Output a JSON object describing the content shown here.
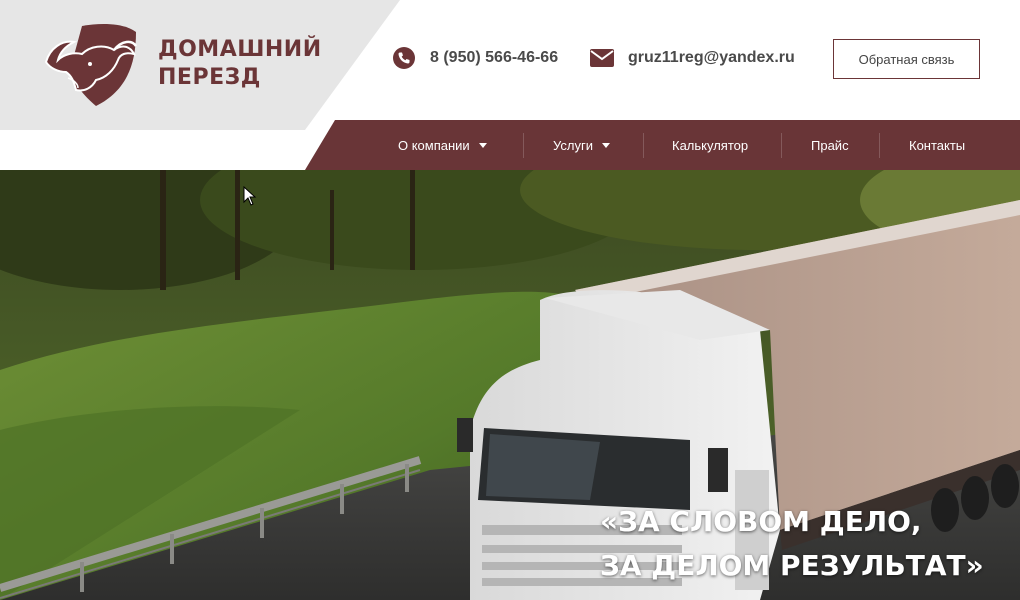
{
  "brand": {
    "line1": "ДОМАШНИЙ",
    "line2": "ПЕРЕЗД",
    "color": "#6b3537",
    "logo_icon": "bull-head-icon"
  },
  "contacts": {
    "phone": "8 (950) 566-46-66",
    "phone_icon": "phone-icon",
    "email": "gruz11reg@yandex.ru",
    "email_icon": "envelope-icon"
  },
  "feedback_button": "Обратная связь",
  "nav": {
    "background": "#693537",
    "items": [
      {
        "label": "О компании",
        "has_dropdown": true
      },
      {
        "label": "Услуги",
        "has_dropdown": true
      },
      {
        "label": "Калькулятор",
        "has_dropdown": false
      },
      {
        "label": "Прайс",
        "has_dropdown": false
      },
      {
        "label": "Контакты",
        "has_dropdown": false
      }
    ]
  },
  "hero": {
    "line1": "«ЗА СЛОВОМ ДЕЛО,",
    "line2": "ЗА ДЕЛОМ РЕЗУЛЬТАТ»"
  }
}
